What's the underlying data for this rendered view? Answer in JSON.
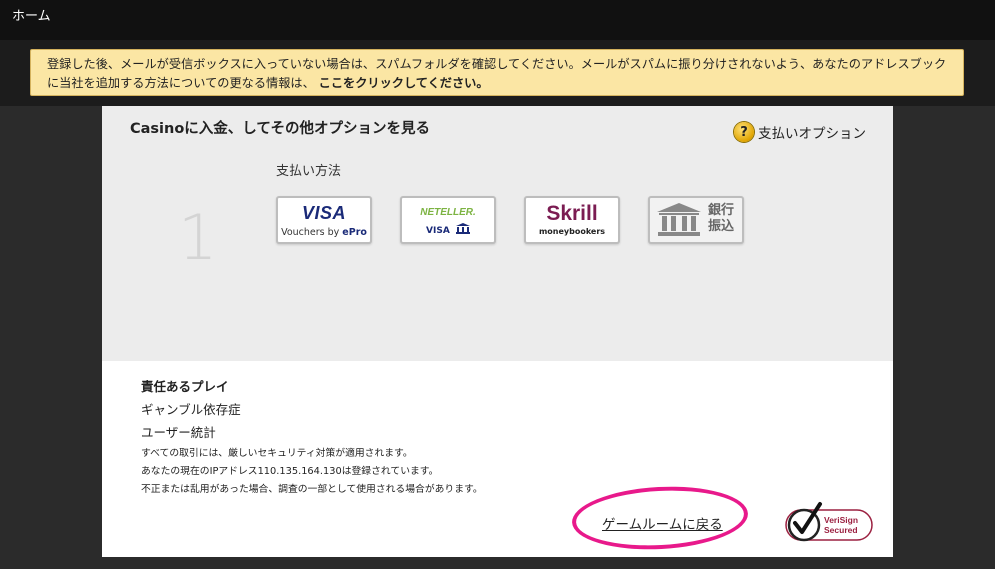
{
  "nav": {
    "home_label": "ホーム"
  },
  "notice": {
    "text": "登録した後、メールが受信ボックスに入っていない場合は、スパムフォルダを確認してください。メールがスパムに振り分けされないよう、あなたのアドレスブックに当社を追加する方法についての更なる情報は、",
    "link_label": "ここをクリックしてください。",
    "background": "#fbe6a4"
  },
  "deposit": {
    "title": "Casinoに入金、してその他オプションを見る",
    "payment_options_label": "支払いオプション",
    "help_icon_glyph": "?",
    "step_number": "1",
    "methods_label": "支払い方法",
    "methods": [
      {
        "id": "visa-epro",
        "title": "VISA",
        "subtitle": "Vouchers by ",
        "subtitle_brand": "ePro"
      },
      {
        "id": "neteller",
        "title": "NETELLER.",
        "subtitle": "VISA"
      },
      {
        "id": "skrill",
        "title": "Skrill",
        "subtitle": "moneybookers"
      },
      {
        "id": "bank-transfer",
        "title": "銀行振込",
        "icon": "bank-building-icon"
      }
    ]
  },
  "footer": {
    "responsible_heading": "責任あるプレイ",
    "links": [
      "ギャンブル依存症",
      "ユーザー統計"
    ],
    "security_lines": [
      "すべての取引には、厳しいセキュリティ対策が適用されます。",
      "あなたの現在のIPアドレス110.135.164.130は登録されています。",
      "不正または乱用があった場合、調査の一部として使用される場合があります。"
    ],
    "back_to_lobby": "ゲームルームに戻る",
    "highlight_color": "#e8198b",
    "verisign_line1": "VeriSign",
    "verisign_line2": "Secured"
  }
}
